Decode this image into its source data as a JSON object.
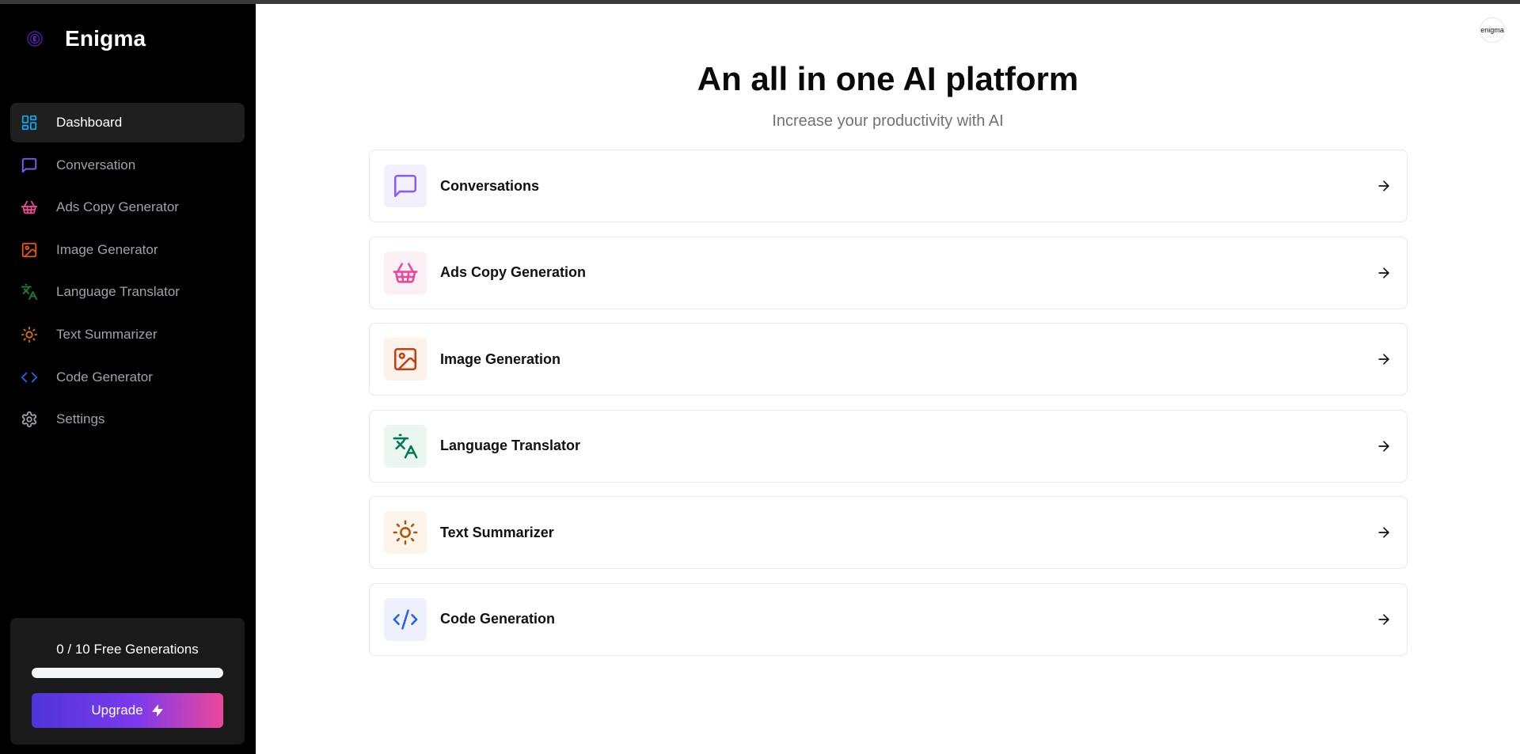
{
  "app": {
    "name": "Enigma"
  },
  "sidebar": {
    "items": [
      {
        "label": "Dashboard",
        "icon": "dashboard-icon",
        "color": "#0ea5e9",
        "active": true
      },
      {
        "label": "Conversation",
        "icon": "message-square-icon",
        "color": "#8b5cf6",
        "active": false
      },
      {
        "label": "Ads Copy Generator",
        "icon": "shopping-basket-icon",
        "color": "#ec4899",
        "active": false
      },
      {
        "label": "Image Generator",
        "icon": "image-icon",
        "color": "#ea580c",
        "active": false
      },
      {
        "label": "Language Translator",
        "icon": "languages-icon",
        "color": "#15803d",
        "active": false
      },
      {
        "label": "Text Summarizer",
        "icon": "sun-icon",
        "color": "#d97706",
        "active": false
      },
      {
        "label": "Code Generator",
        "icon": "code-icon",
        "color": "#2563eb",
        "active": false
      },
      {
        "label": "Settings",
        "icon": "gear-icon",
        "color": "#a1a1aa",
        "active": false
      }
    ],
    "usage": {
      "text": "0 / 10 Free Generations",
      "used": 0,
      "limit": 10
    },
    "upgrade_label": "Upgrade"
  },
  "header": {
    "avatar_text": "enigma"
  },
  "hero": {
    "title": "An all in one AI platform",
    "subtitle": "Increase your productivity with AI"
  },
  "tools": [
    {
      "label": "Conversations",
      "icon": "message-square-icon",
      "color": "#8b5cf6",
      "bg": "#f3f0fe"
    },
    {
      "label": "Ads Copy Generation",
      "icon": "shopping-basket-icon",
      "color": "#ec4899",
      "bg": "#fcf0f6"
    },
    {
      "label": "Image Generation",
      "icon": "image-icon",
      "color": "#c2410c",
      "bg": "#fdf1ec"
    },
    {
      "label": "Language Translator",
      "icon": "languages-icon",
      "color": "#047857",
      "bg": "#ecf6f1"
    },
    {
      "label": "Text Summarizer",
      "icon": "sun-icon",
      "color": "#b45309",
      "bg": "#fdf5ea"
    },
    {
      "label": "Code Generation",
      "icon": "code-icon",
      "color": "#2563eb",
      "bg": "#eef1fd"
    }
  ],
  "colors": {
    "sidebar_bg": "#000000",
    "accent_start": "#4f35d9",
    "accent_end": "#ec4899"
  }
}
